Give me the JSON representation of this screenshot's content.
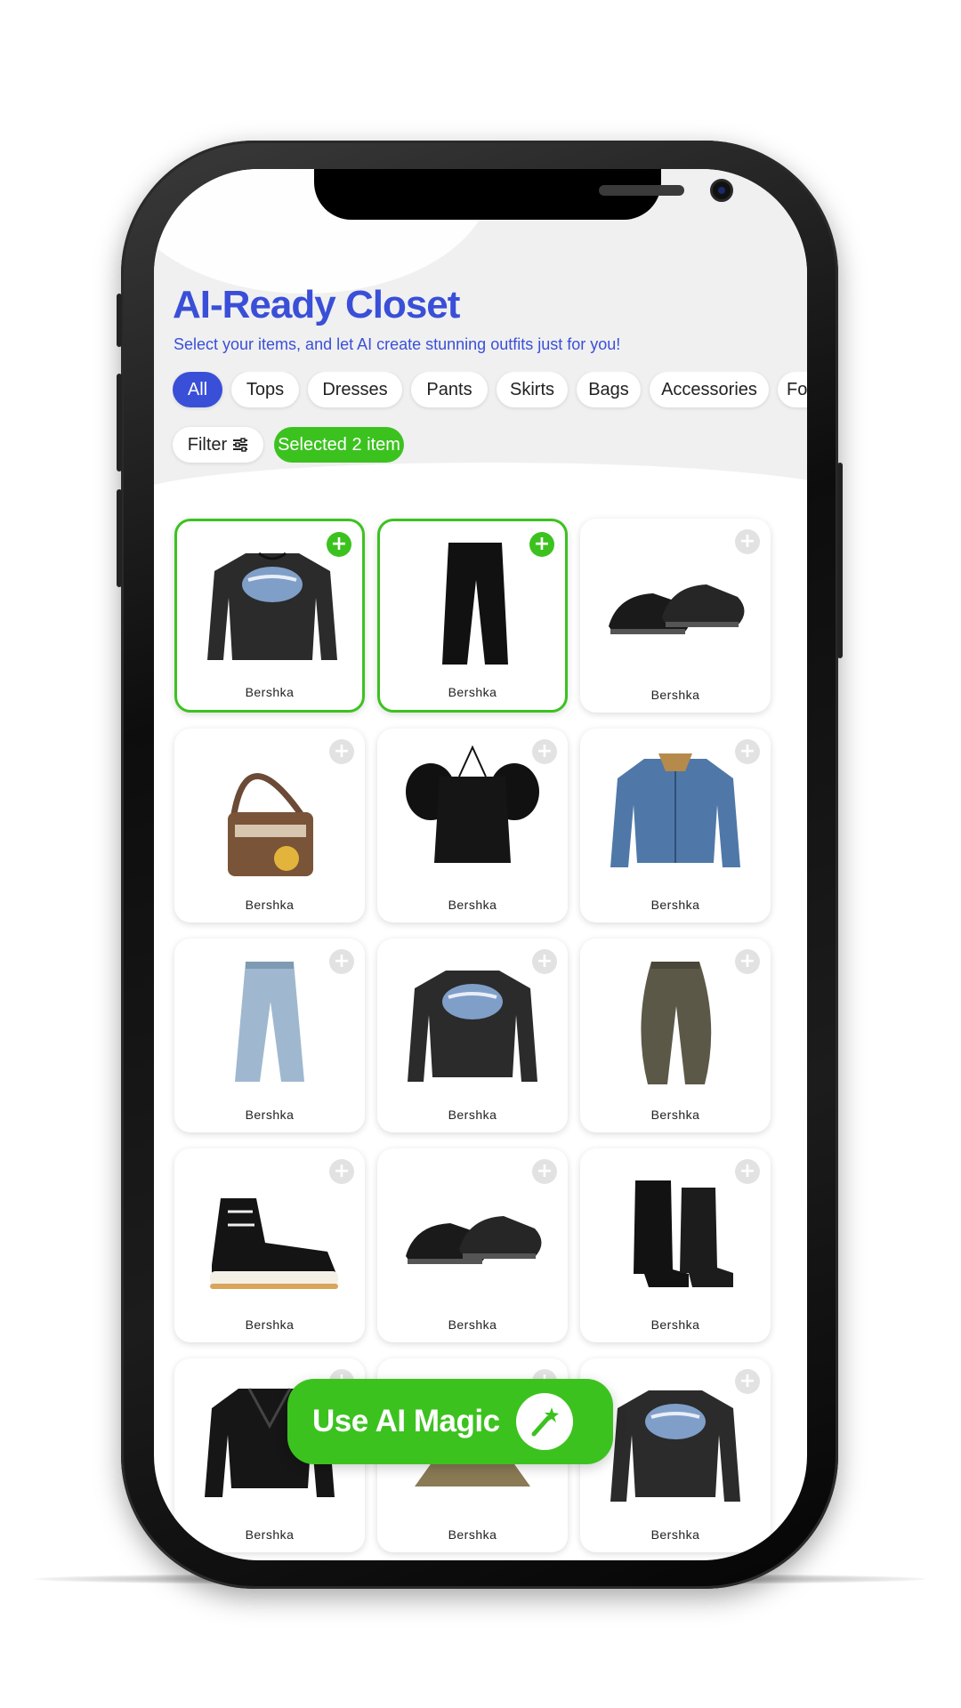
{
  "header": {
    "title": "AI-Ready Closet",
    "subtitle": "Select your items, and let AI create stunning outfits just for you!"
  },
  "categories": [
    {
      "label": "All",
      "active": true
    },
    {
      "label": "Tops",
      "active": false
    },
    {
      "label": "Dresses",
      "active": false
    },
    {
      "label": "Pants",
      "active": false
    },
    {
      "label": "Skirts",
      "active": false
    },
    {
      "label": "Bags",
      "active": false
    },
    {
      "label": "Accessories",
      "active": false
    },
    {
      "label": "Fo",
      "active": false
    }
  ],
  "toolbar": {
    "filter_label": "Filter",
    "filter_icon": "sliders-icon",
    "selected_label": "Selected 2 item"
  },
  "items": [
    {
      "brand": "Bershka",
      "type": "sweatshirt",
      "selected": true
    },
    {
      "brand": "Bershka",
      "type": "black-trousers",
      "selected": true
    },
    {
      "brand": "Bershka",
      "type": "loafers",
      "selected": false
    },
    {
      "brand": "Bershka",
      "type": "shoulder-bag",
      "selected": false
    },
    {
      "brand": "Bershka",
      "type": "puff-sleeve-top",
      "selected": false
    },
    {
      "brand": "Bershka",
      "type": "denim-jacket",
      "selected": false
    },
    {
      "brand": "Bershka",
      "type": "light-jeans",
      "selected": false
    },
    {
      "brand": "Bershka",
      "type": "sweatshirt",
      "selected": false
    },
    {
      "brand": "Bershka",
      "type": "barrel-jeans",
      "selected": false
    },
    {
      "brand": "Bershka",
      "type": "high-top-sneakers",
      "selected": false
    },
    {
      "brand": "Bershka",
      "type": "loafers",
      "selected": false
    },
    {
      "brand": "Bershka",
      "type": "ankle-boots",
      "selected": false
    },
    {
      "brand": "Bershka",
      "type": "leather-jacket",
      "selected": false
    },
    {
      "brand": "Bershka",
      "type": "skirt",
      "selected": false
    },
    {
      "brand": "Bershka",
      "type": "sweatshirt",
      "selected": false
    }
  ],
  "cta": {
    "label": "Use AI Magic",
    "icon": "magic-wand-icon"
  },
  "colors": {
    "accent_blue": "#3a4fd8",
    "accent_green": "#3cc21f"
  }
}
